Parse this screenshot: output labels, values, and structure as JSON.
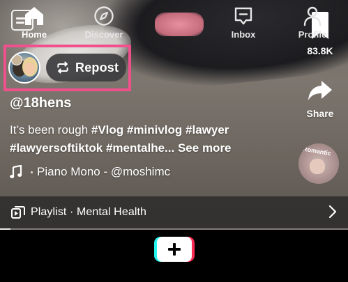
{
  "video": {
    "progress_fraction": 0.03
  },
  "author": {
    "username": "@18hens"
  },
  "repost": {
    "label": "Repost",
    "highlight_color": "#f0508c"
  },
  "caption": {
    "prefix": "It’s been rough ",
    "line1_tags": [
      "#Vlog",
      "#minivlog",
      "#lawyer"
    ],
    "line2_tags": [
      "#lawyersoftiktok",
      "#mentalhe..."
    ],
    "see_more": "See more"
  },
  "music": {
    "track": "Piano Mono - @moshimc",
    "disc_text": "Romantic"
  },
  "actions": {
    "bookmark_count": "83.8K",
    "share_label": "Share"
  },
  "playlist": {
    "label": "Playlist · Mental Health"
  },
  "nav": {
    "home": "Home",
    "discover": "Discover",
    "inbox": "Inbox",
    "profile": "Profile"
  },
  "icons": {
    "caption": "captions-icon",
    "repost": "repost-icon",
    "bookmark": "bookmark-icon",
    "share": "share-arrow-icon",
    "music_note": "music-note-icon",
    "playlist": "playlist-icon",
    "chevron": "chevron-right-icon",
    "home": "home-icon",
    "discover": "compass-icon",
    "create": "plus-icon",
    "inbox": "inbox-icon",
    "profile": "profile-icon"
  },
  "colors": {
    "create_cyan": "#25f4ee",
    "create_red": "#fe2c55"
  }
}
